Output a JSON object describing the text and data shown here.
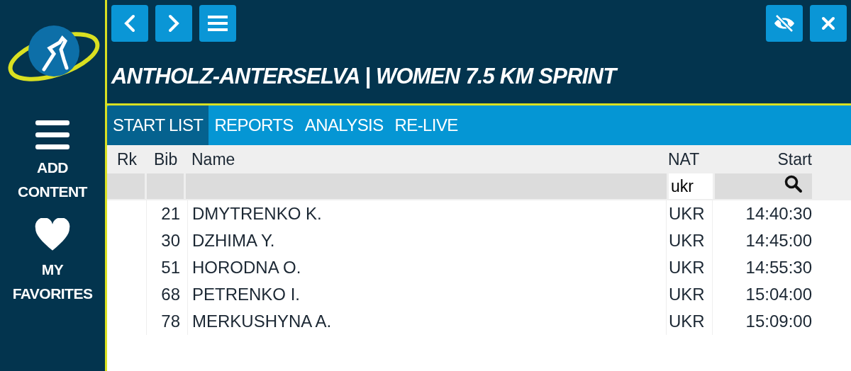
{
  "sidebar": {
    "items": [
      {
        "kind": "menu",
        "label": "ADD CONTENT"
      },
      {
        "kind": "heart",
        "label": "MY FAVORITES"
      }
    ]
  },
  "toolbar": {
    "title": "ANTHOLZ-ANTERSELVA | WOMEN 7.5 KM SPRINT"
  },
  "tabs": [
    {
      "label": "START LIST",
      "selected": true
    },
    {
      "label": "REPORTS",
      "selected": false
    },
    {
      "label": "ANALYSIS",
      "selected": false
    },
    {
      "label": "RE-LIVE",
      "selected": false
    }
  ],
  "table": {
    "columns": [
      "Rk",
      "Bib",
      "Name",
      "NAT",
      "Start"
    ],
    "filters": {
      "nat": "ukr"
    },
    "rows": [
      {
        "bib": "21",
        "name": "DMYTRENKO K.",
        "nat": "UKR",
        "start": "14:40:30"
      },
      {
        "bib": "30",
        "name": "DZHIMA Y.",
        "nat": "UKR",
        "start": "14:45:00"
      },
      {
        "bib": "51",
        "name": "HORODNA O.",
        "nat": "UKR",
        "start": "14:55:30"
      },
      {
        "bib": "68",
        "name": "PETRENKO I.",
        "nat": "UKR",
        "start": "15:04:00"
      },
      {
        "bib": "78",
        "name": "MERKUSHYNA A.",
        "nat": "UKR",
        "start": "15:09:00"
      }
    ]
  }
}
